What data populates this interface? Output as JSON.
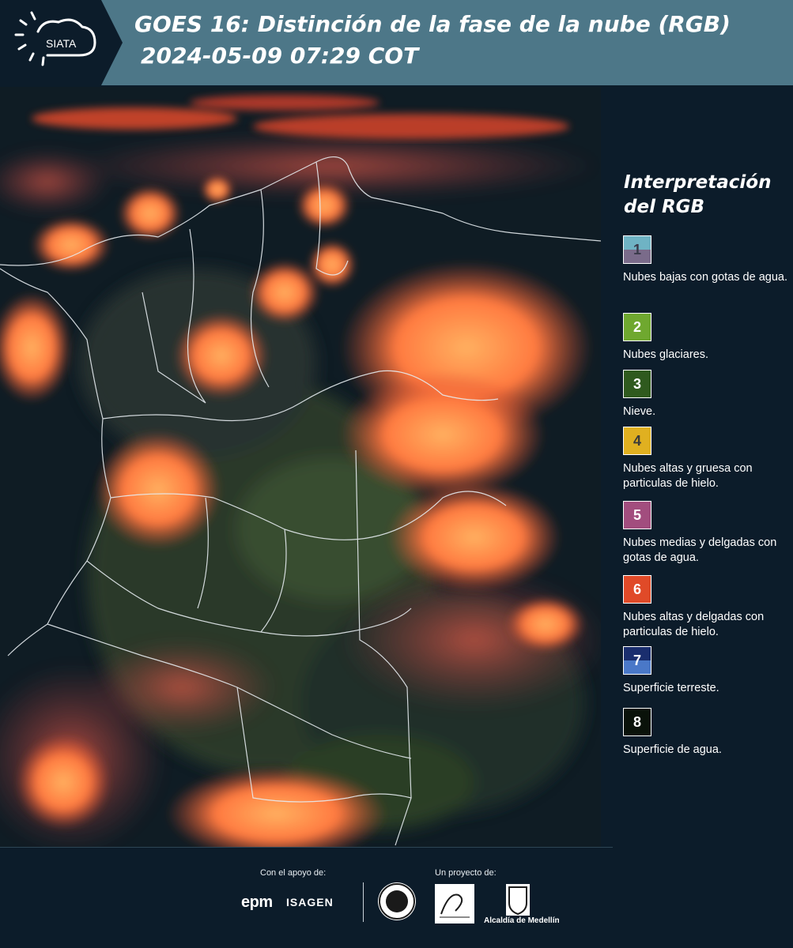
{
  "header": {
    "logo_text": "SIATA",
    "title_line1": "GOES 16: Distinción de la fase de la nube (RGB)",
    "title_line2": "2024-05-09 07:29 COT"
  },
  "map": {
    "description_colors": {
      "cloud": "#ff6a3a",
      "land": "#2a3a2e",
      "water": "#0d1a22"
    }
  },
  "legend": {
    "title": "Interpretación del RGB",
    "items": [
      {
        "num": "1",
        "label": "Nubes bajas con gotas de agua.",
        "color_top": "#6fb3c4",
        "color_bottom": "#7a6b8a",
        "text_color": "#3a3a4a"
      },
      {
        "num": "2",
        "label": "Nubes glaciares.",
        "color_top": "#6fa82f",
        "color_bottom": "#6fa82f",
        "text_color": "#ffffff"
      },
      {
        "num": "3",
        "label": "Nieve.",
        "color_top": "#2f5a1e",
        "color_bottom": "#2f5a1e",
        "text_color": "#ffffff"
      },
      {
        "num": "4",
        "label": "Nubes altas y gruesa con particulas de hielo.",
        "color_top": "#e0b020",
        "color_bottom": "#e0b020",
        "text_color": "#3a3a3a"
      },
      {
        "num": "5",
        "label": "Nubes medias y delgadas con gotas de agua.",
        "color_top": "#a24d7e",
        "color_bottom": "#a24d7e",
        "text_color": "#ffffff"
      },
      {
        "num": "6",
        "label": "Nubes altas y delgadas con particulas de hielo.",
        "color_top": "#e04a28",
        "color_bottom": "#e04a28",
        "text_color": "#ffffff"
      },
      {
        "num": "7",
        "label": "Superficie terreste.",
        "color_top": "#1a2e6e",
        "color_bottom": "#4a78c8",
        "text_color": "#ffffff"
      },
      {
        "num": "8",
        "label": "Superficie de agua.",
        "color_top": "#0a120a",
        "color_bottom": "#0a120a",
        "text_color": "#ffffff"
      }
    ]
  },
  "footer": {
    "support_label": "Con el apoyo de:",
    "project_label": "Un proyecto de:",
    "epm": "epm",
    "isagen": "ISAGEN",
    "alcaldia": "Alcaldía de Medellín"
  }
}
